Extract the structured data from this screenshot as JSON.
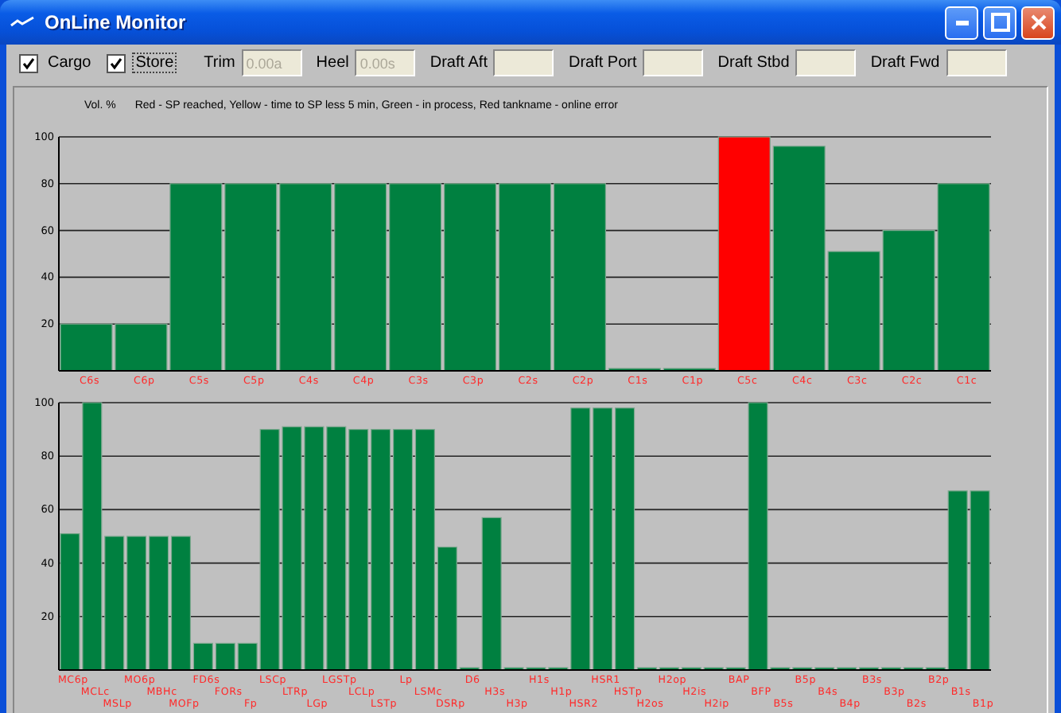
{
  "window": {
    "title": "OnLine Monitor"
  },
  "toolbar": {
    "checkboxes": [
      {
        "label": "Cargo",
        "checked": true,
        "focused": false
      },
      {
        "label": "Store",
        "checked": true,
        "focused": true
      }
    ],
    "fields": [
      {
        "label": "Trim",
        "value": "0.00a",
        "disabled": true
      },
      {
        "label": "Heel",
        "value": "0.00s",
        "disabled": true
      },
      {
        "label": "Draft Aft",
        "disabled": true
      },
      {
        "label": "Draft Port",
        "disabled": true
      },
      {
        "label": "Draft Stbd",
        "disabled": true
      },
      {
        "label": "Draft Fwd",
        "disabled": true
      }
    ]
  },
  "legend": {
    "unit": "Vol. %",
    "text": "Red - SP reached,  Yellow - time to SP less 5 min, Green - in process, Red tankname - online error"
  },
  "charts": [
    {
      "chart_data": {
        "type": "bar",
        "stacked": true,
        "grid": true,
        "ylim": [
          0,
          100
        ],
        "yticks": [
          20,
          40,
          60,
          80,
          100
        ],
        "categories": [
          "C6s",
          "C6p",
          "C5s",
          "C5p",
          "C4s",
          "C4p",
          "C3s",
          "C3p",
          "C2s",
          "C2p",
          "C1s",
          "C1p",
          "C5c",
          "C4c",
          "C3c",
          "C2c",
          "C1c"
        ],
        "series": [
          {
            "color": "#008040",
            "values": [
              20,
              20,
              80,
              80,
              80,
              80,
              80,
              80,
              80,
              80,
              0,
              0,
              null,
              96,
              51,
              60,
              80
            ]
          },
          {
            "color": "#ff0000",
            "values": [
              null,
              null,
              null,
              null,
              null,
              null,
              null,
              null,
              null,
              null,
              null,
              null,
              100,
              null,
              null,
              null,
              null
            ]
          }
        ]
      }
    },
    {
      "chart_data": {
        "type": "bar",
        "grid": true,
        "ylim": [
          0,
          100
        ],
        "yticks": [
          20,
          40,
          60,
          80,
          100
        ],
        "categories": [
          "MC6p",
          "MCLc",
          "MSLp",
          "MO6p",
          "MBHc",
          "MOFp",
          "FD6s",
          "FORs",
          "Fp",
          "LSCp",
          "LTRp",
          "LGp",
          "LGSTp",
          "LCLp",
          "LSTp",
          "Lp",
          "LSMc",
          "DSRp",
          "D6",
          "H3s",
          "H3p",
          "H1s",
          "H1p",
          "HSR2",
          "HSR1",
          "HSTp",
          "H2os",
          "H2op",
          "H2is",
          "H2ip",
          "BAP",
          "BFP",
          "B5s",
          "B5p",
          "B4s",
          "B4p",
          "B3s",
          "B3p",
          "B2s",
          "B2p",
          "B1s",
          "B1p"
        ],
        "series": [
          {
            "color": "#008040",
            "values": [
              51,
              100,
              50,
              50,
              50,
              50,
              10,
              10,
              10,
              90,
              91,
              91,
              91,
              90,
              90,
              90,
              90,
              46,
              0,
              57,
              0,
              0,
              0,
              98,
              98,
              98,
              0,
              0,
              0,
              0,
              0,
              100,
              0,
              0,
              0,
              0,
              0,
              0,
              0,
              0,
              67,
              67
            ]
          }
        ]
      }
    }
  ]
}
